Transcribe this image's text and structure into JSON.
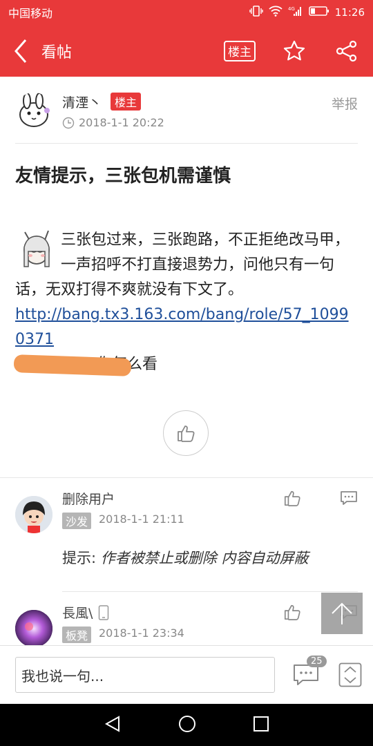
{
  "status": {
    "carrier": "中国移动",
    "network": "4G",
    "time": "11:26"
  },
  "topbar": {
    "title": "看帖",
    "owner_label": "楼主"
  },
  "post": {
    "author": "清湮丶",
    "owner_badge": "楼主",
    "time": "2018-1-1 20:22",
    "report_label": "举报",
    "title": "友情提示，三张包机需谨慎",
    "body_text": "三张包过来，三张跑路，不正拒绝改马甲，一声招呼不打直接退势力，问他只有一句话，无双打得不爽就没有下文了。",
    "link": "http://bang.tx3.163.com/bang/role/57_10990371",
    "tail_text": "你怎么看"
  },
  "comments": [
    {
      "name": "删除用户",
      "floor": "沙发",
      "time": "2018-1-1 21:11",
      "tip_prefix": "提示:",
      "tip_text": "作者被禁止或删除 内容自动屏蔽"
    },
    {
      "name": "長風\\",
      "floor": "板凳",
      "time": "2018-1-1 23:34"
    }
  ],
  "bottom": {
    "placeholder": "我也说一句...",
    "comment_count": "25"
  },
  "colors": {
    "brand": "#e8393a",
    "link": "#1f4f9a"
  }
}
